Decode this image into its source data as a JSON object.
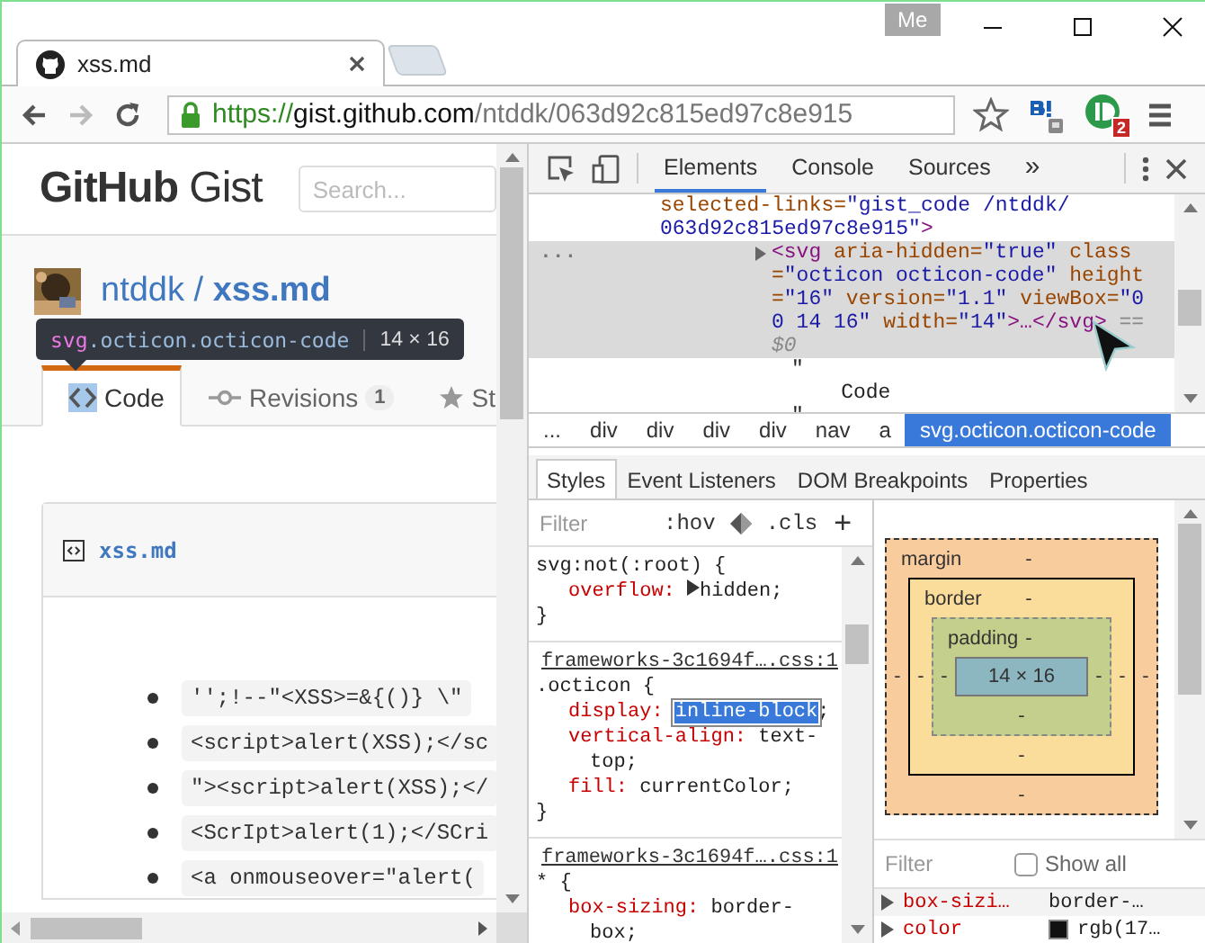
{
  "browser": {
    "tab": {
      "title": "xss.md"
    },
    "profile": "Me",
    "url": {
      "scheme": "https://",
      "host": "gist.github.com",
      "path": "/ntddk/063d92c815ed97c8e915"
    },
    "extension_badge": "2"
  },
  "page": {
    "logo": {
      "bold": "GitHub",
      "light": "Gist"
    },
    "search": {
      "placeholder": "Search..."
    },
    "owner": "ntddk",
    "separator": "/",
    "gist_name": "xss.md",
    "tabs": [
      {
        "label": "Code",
        "selected": true,
        "kind": "code"
      },
      {
        "label": "Revisions",
        "count": "1",
        "selected": false,
        "kind": "commit"
      },
      {
        "label": "St",
        "selected": false,
        "kind": "star"
      }
    ],
    "file": {
      "name": "xss.md"
    },
    "list_items": [
      "'';!--\"<XSS>=&{()} \\\"",
      "<script>alert(XSS);</sc",
      "\"><script>alert(XSS);</",
      "<ScrIpt>alert(1);</SCri",
      "<a onmouseover=\"alert("
    ]
  },
  "tooltip": {
    "tag": "svg",
    "classes": ".octicon.octicon-code",
    "size": "14 × 16"
  },
  "devtools": {
    "tabs": [
      {
        "label": "Elements",
        "selected": true
      },
      {
        "label": "Console",
        "selected": false
      },
      {
        "label": "Sources",
        "selected": false
      }
    ],
    "more": "»",
    "tree": [
      {
        "lines": [
          [
            {
              "kind": "attr",
              "text": "selected-links="
            },
            {
              "kind": "value",
              "text": "\"gist_code /ntddk/"
            }
          ],
          [
            {
              "kind": "value",
              "text": "063d92c815ed97c8e915\""
            },
            {
              "kind": "tag",
              "text": ">"
            }
          ]
        ],
        "children": [
          {
            "kind": "element",
            "selected": true,
            "expanded": false,
            "gutter": "...",
            "tokens": [
              {
                "kind": "tag",
                "text": "<svg "
              },
              {
                "kind": "attr",
                "text": "aria-hidden="
              },
              {
                "kind": "value",
                "text": "\"true\" "
              },
              {
                "kind": "attr",
                "text": "class="
              },
              {
                "kind": "value",
                "text": "\"octicon octicon-code\" "
              },
              {
                "kind": "attr",
                "text": "height="
              },
              {
                "kind": "value",
                "text": "\"16\" "
              },
              {
                "kind": "attr",
                "text": "version="
              },
              {
                "kind": "value",
                "text": "\"1.1\" "
              },
              {
                "kind": "attr",
                "text": "viewBox="
              },
              {
                "kind": "value",
                "text": "\"0 0 14 16\" "
              },
              {
                "kind": "attr",
                "text": "width="
              },
              {
                "kind": "value",
                "text": "\"14\""
              },
              {
                "kind": "tag",
                "text": ">…</svg>"
              },
              {
                "kind": "dim",
                "text": " == $0"
              }
            ]
          },
          {
            "kind": "text",
            "text": "\"\n    Code\n\""
          }
        ]
      }
    ],
    "breadcrumbs": [
      {
        "label": "...",
        "selected": false
      },
      {
        "label": "div",
        "selected": false
      },
      {
        "label": "div",
        "selected": false
      },
      {
        "label": "div",
        "selected": false
      },
      {
        "label": "div",
        "selected": false
      },
      {
        "label": "nav",
        "selected": false
      },
      {
        "label": "a",
        "selected": false
      },
      {
        "label": "svg.octicon.octicon-code",
        "selected": true
      }
    ],
    "subtabs": [
      {
        "label": "Styles",
        "selected": true
      },
      {
        "label": "Event Listeners",
        "selected": false
      },
      {
        "label": "DOM Breakpoints",
        "selected": false
      },
      {
        "label": "Properties",
        "selected": false
      }
    ],
    "styles_filter": {
      "placeholder": "Filter",
      "hov": ":hov",
      "cls": ".cls",
      "add": "+"
    },
    "rules": [
      {
        "selector": "svg:not(:root) {",
        "declarations": [
          {
            "name": "overflow:",
            "value": "hidden",
            "end": ";",
            "expandable": true,
            "selected": false
          }
        ],
        "close": "}"
      },
      {
        "source": "frameworks-3c1694f….css:1",
        "selector": ".octicon {",
        "declarations": [
          {
            "name": "display:",
            "value": "inline-block",
            "end": ";",
            "expandable": false,
            "selected": true
          },
          {
            "name": "vertical-align:",
            "value": "text-top",
            "end": ";",
            "expandable": false,
            "selected": false
          },
          {
            "name": "fill:",
            "value": "currentColor",
            "end": ";",
            "expandable": false,
            "selected": false
          }
        ],
        "close": "}"
      },
      {
        "source": "frameworks-3c1694f….css:1",
        "selector": "* {",
        "declarations": [
          {
            "name": "box-sizing:",
            "value": "border-box",
            "end": ";",
            "expandable": false,
            "selected": false
          }
        ]
      }
    ],
    "box_model": {
      "margin": {
        "label": "margin",
        "top": "-",
        "right": "-",
        "bottom": "-",
        "left": "-"
      },
      "border": {
        "label": "border",
        "top": "-",
        "right": "-",
        "bottom": "-",
        "left": "-"
      },
      "padding": {
        "label": "padding",
        "top": "-",
        "right": "-",
        "bottom": "-",
        "left": "-"
      },
      "content": "14 × 16"
    },
    "computed": {
      "filter_placeholder": "Filter",
      "show_all": {
        "label": "Show all",
        "checked": false
      },
      "rows": [
        {
          "property": "box-sizi…",
          "value": "border-…"
        },
        {
          "property": "color",
          "value": "rgb(17…",
          "color": "#111111"
        }
      ]
    }
  }
}
